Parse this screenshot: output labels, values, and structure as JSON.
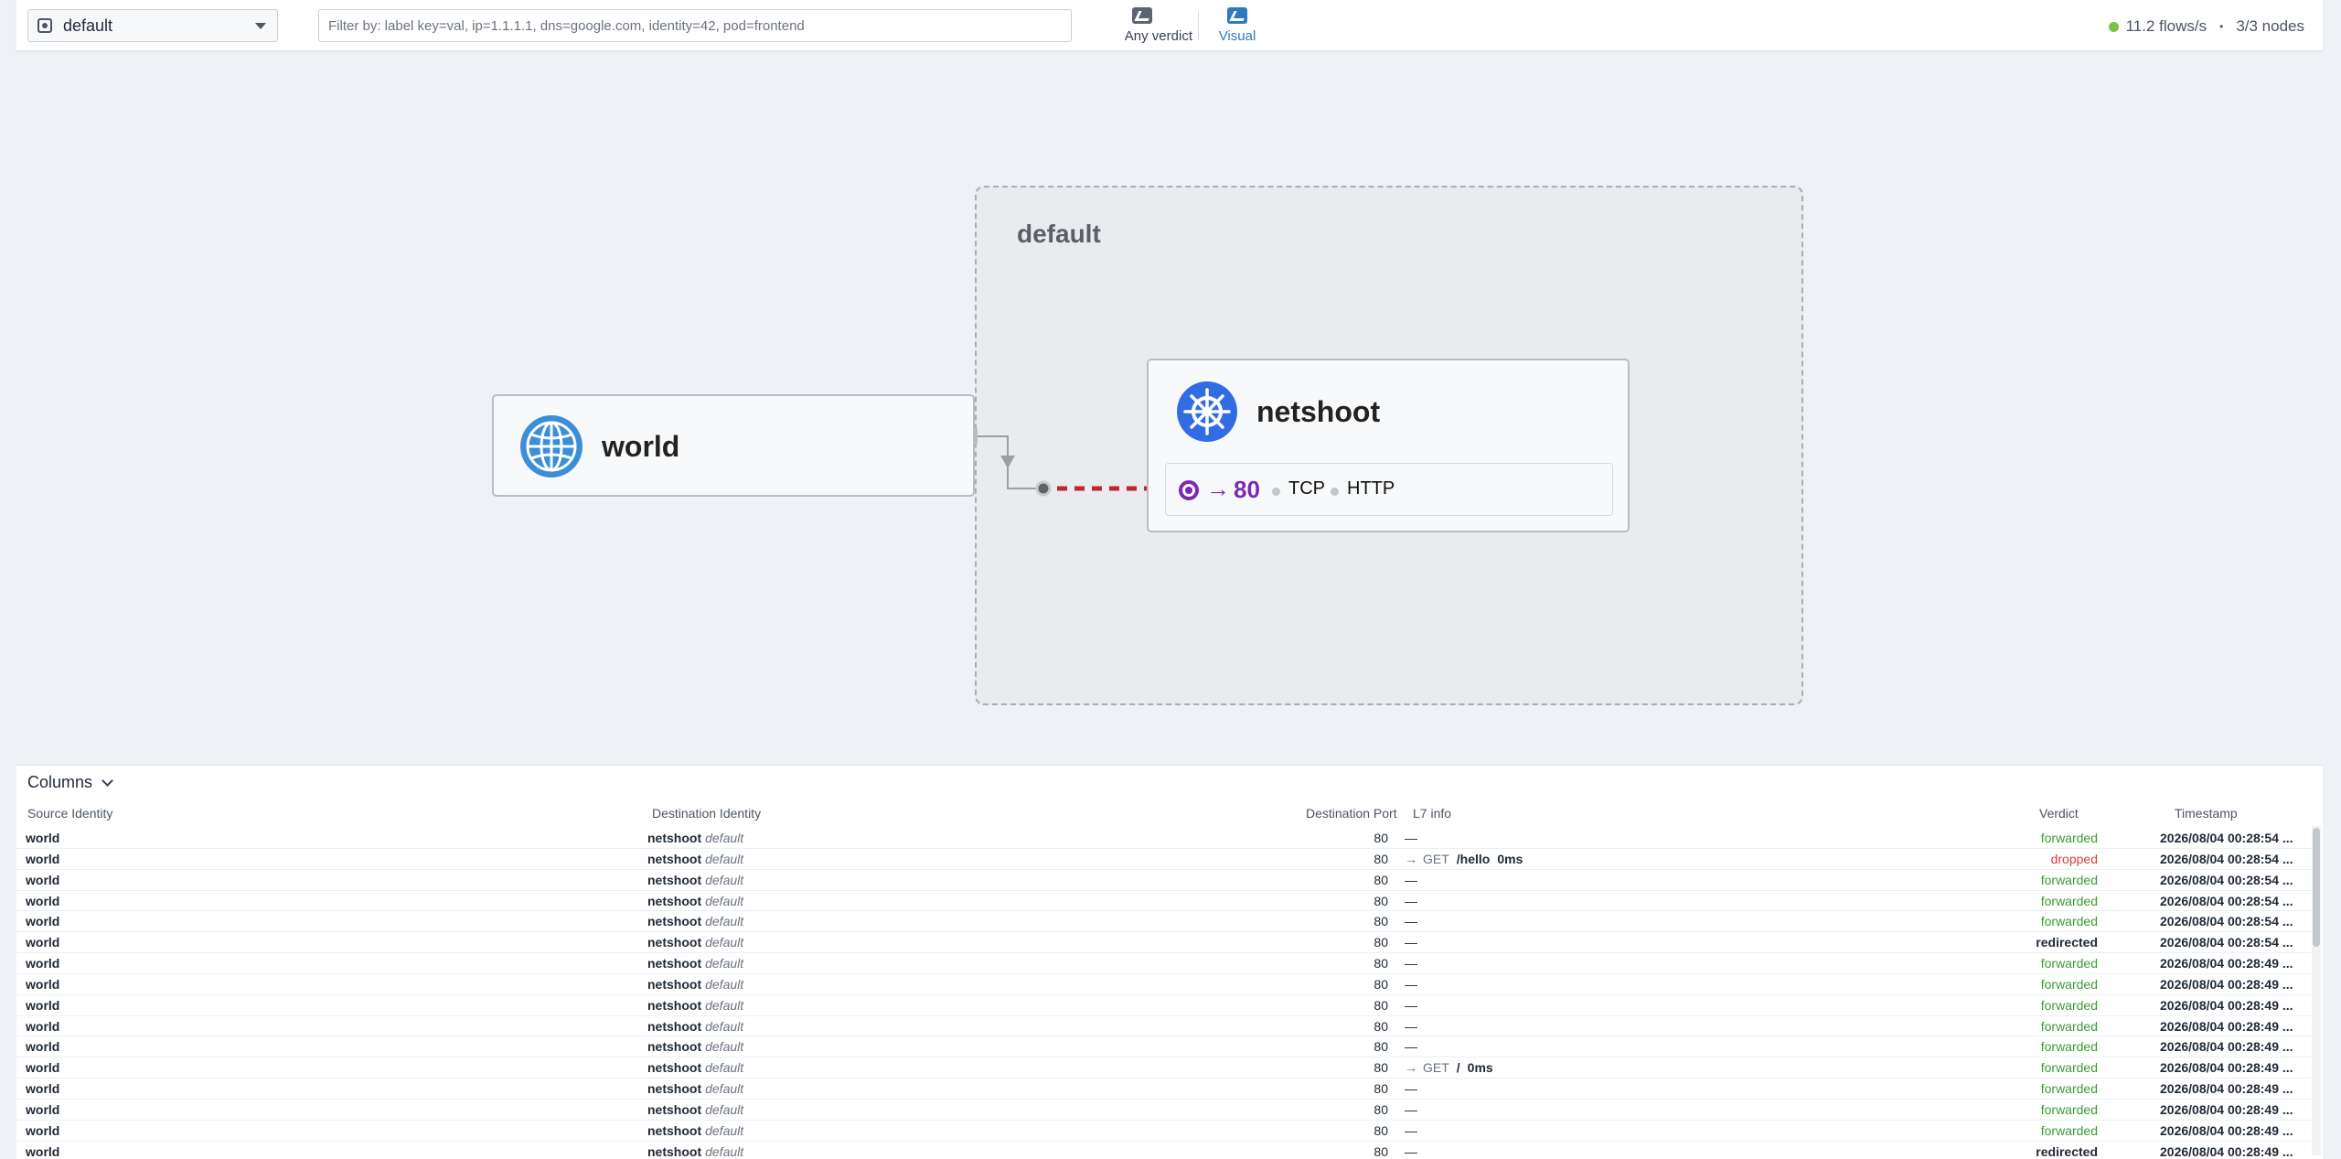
{
  "toolbar": {
    "namespace": "default",
    "filter_placeholder": "Filter by: label key=val, ip=1.1.1.1, dns=google.com, identity=42, pod=frontend",
    "verdict_label": "Any verdict",
    "visual_label": "Visual"
  },
  "status": {
    "flows": "11.2 flows/s",
    "separator": "•",
    "nodes": "3/3 nodes"
  },
  "map": {
    "namespace_title": "default",
    "world_label": "world",
    "netshoot_label": "netshoot",
    "port": {
      "arrow": "→",
      "number": "80",
      "protocol1": "TCP",
      "protocol2": "HTTP"
    },
    "colors": {
      "port_accent": "#7b2ab5",
      "dropped_link": "#c0262d",
      "k8s_blue": "#326ce5",
      "globe_blue": "#3b8fd6"
    }
  },
  "table": {
    "columns_button": "Columns",
    "headers": {
      "src": "Source Identity",
      "dst": "Destination Identity",
      "port": "Destination Port",
      "l7": "L7 info",
      "verdict": "Verdict",
      "ts": "Timestamp"
    },
    "rows": [
      {
        "src": "world",
        "dst": "netshoot",
        "dst_ns": "default",
        "port": "80",
        "l7": "—",
        "verdict": "forwarded",
        "ts": "2026/08/04 00:28:54 ..."
      },
      {
        "src": "world",
        "dst": "netshoot",
        "dst_ns": "default",
        "port": "80",
        "l7_arrow": "→",
        "l7_method": "GET",
        "l7_path": "/hello",
        "l7_latency": "0ms",
        "verdict": "dropped",
        "ts": "2026/08/04 00:28:54 ..."
      },
      {
        "src": "world",
        "dst": "netshoot",
        "dst_ns": "default",
        "port": "80",
        "l7": "—",
        "verdict": "forwarded",
        "ts": "2026/08/04 00:28:54 ..."
      },
      {
        "src": "world",
        "dst": "netshoot",
        "dst_ns": "default",
        "port": "80",
        "l7": "—",
        "verdict": "forwarded",
        "ts": "2026/08/04 00:28:54 ..."
      },
      {
        "src": "world",
        "dst": "netshoot",
        "dst_ns": "default",
        "port": "80",
        "l7": "—",
        "verdict": "forwarded",
        "ts": "2026/08/04 00:28:54 ..."
      },
      {
        "src": "world",
        "dst": "netshoot",
        "dst_ns": "default",
        "port": "80",
        "l7": "—",
        "verdict": "redirected",
        "ts": "2026/08/04 00:28:54 ..."
      },
      {
        "src": "world",
        "dst": "netshoot",
        "dst_ns": "default",
        "port": "80",
        "l7": "—",
        "verdict": "forwarded",
        "ts": "2026/08/04 00:28:49 ..."
      },
      {
        "src": "world",
        "dst": "netshoot",
        "dst_ns": "default",
        "port": "80",
        "l7": "—",
        "verdict": "forwarded",
        "ts": "2026/08/04 00:28:49 ..."
      },
      {
        "src": "world",
        "dst": "netshoot",
        "dst_ns": "default",
        "port": "80",
        "l7": "—",
        "verdict": "forwarded",
        "ts": "2026/08/04 00:28:49 ..."
      },
      {
        "src": "world",
        "dst": "netshoot",
        "dst_ns": "default",
        "port": "80",
        "l7": "—",
        "verdict": "forwarded",
        "ts": "2026/08/04 00:28:49 ..."
      },
      {
        "src": "world",
        "dst": "netshoot",
        "dst_ns": "default",
        "port": "80",
        "l7": "—",
        "verdict": "forwarded",
        "ts": "2026/08/04 00:28:49 ..."
      },
      {
        "src": "world",
        "dst": "netshoot",
        "dst_ns": "default",
        "port": "80",
        "l7_arrow": "→",
        "l7_method": "GET",
        "l7_path": "/",
        "l7_latency": "0ms",
        "verdict": "forwarded",
        "ts": "2026/08/04 00:28:49 ..."
      },
      {
        "src": "world",
        "dst": "netshoot",
        "dst_ns": "default",
        "port": "80",
        "l7": "—",
        "verdict": "forwarded",
        "ts": "2026/08/04 00:28:49 ..."
      },
      {
        "src": "world",
        "dst": "netshoot",
        "dst_ns": "default",
        "port": "80",
        "l7": "—",
        "verdict": "forwarded",
        "ts": "2026/08/04 00:28:49 ..."
      },
      {
        "src": "world",
        "dst": "netshoot",
        "dst_ns": "default",
        "port": "80",
        "l7": "—",
        "verdict": "forwarded",
        "ts": "2026/08/04 00:28:49 ..."
      },
      {
        "src": "world",
        "dst": "netshoot",
        "dst_ns": "default",
        "port": "80",
        "l7": "—",
        "verdict": "redirected",
        "ts": "2026/08/04 00:28:49 ..."
      }
    ]
  }
}
